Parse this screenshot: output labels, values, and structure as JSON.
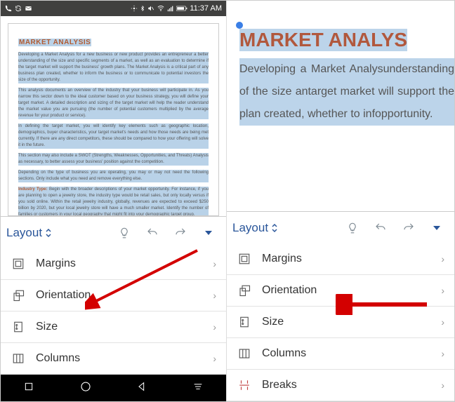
{
  "status": {
    "time": "11:37 AM"
  },
  "document": {
    "title": "MARKET ANALYSIS",
    "paragraphs": [
      "Developing a Market Analysis for a new business or new product provides an entrepreneur a better understanding of the size and specific segments of a market, as well as an evaluation to determine if the target market will support the business' growth plans. The Market Analysis is a critical part of any business plan created, whether to inform the business or to communicate to potential investors the size of the opportunity.",
      "This analysis documents an overview of the industry that your business will participate in. As you narrow this sector down to the ideal customer based on your business strategy, you will define your target market. A detailed description and sizing of the target market will help the reader understand the market value you are pursuing (the number of potential customers multiplied by the average revenue for your product or service).",
      "In defining the target market, you will identify key elements such as geographic location, demographics, buyer characteristics, your target market's needs and how those needs are being met currently. If there are any direct competitors, these should be compared to how your offering will solve it in the future.",
      "This section may also include a SWOT (Strengths, Weaknesses, Opportunities, and Threats) Analysis as necessary, to better assess your business' position against the competition.",
      "Depending on the type of business you are operating, you may or may not need the following sections. Only include what you need and remove everything else."
    ],
    "industry_label": "Industry Type:",
    "industry_text": "Begin with the broader descriptions of your market opportunity. For instance, if you are planning to open a jewelry store, the industry type would be retail sales, but only locally versus if you sold online. Within the retail jewelry industry, globally, revenues are expected to exceed $250 billion by 2020, but your local jewelry store will have a much smaller market. Identify the number of families or customers in your local geography that might fit into your demographic target group."
  },
  "zoom": {
    "title": "MARKET ANALYS",
    "body": "Developing a Market Analysunderstanding of the size antarget market will support theplan created, whether to infopportunity."
  },
  "layout": {
    "label": "Layout"
  },
  "menu": {
    "margins": "Margins",
    "orientation": "Orientation",
    "size": "Size",
    "columns": "Columns",
    "breaks": "Breaks"
  }
}
